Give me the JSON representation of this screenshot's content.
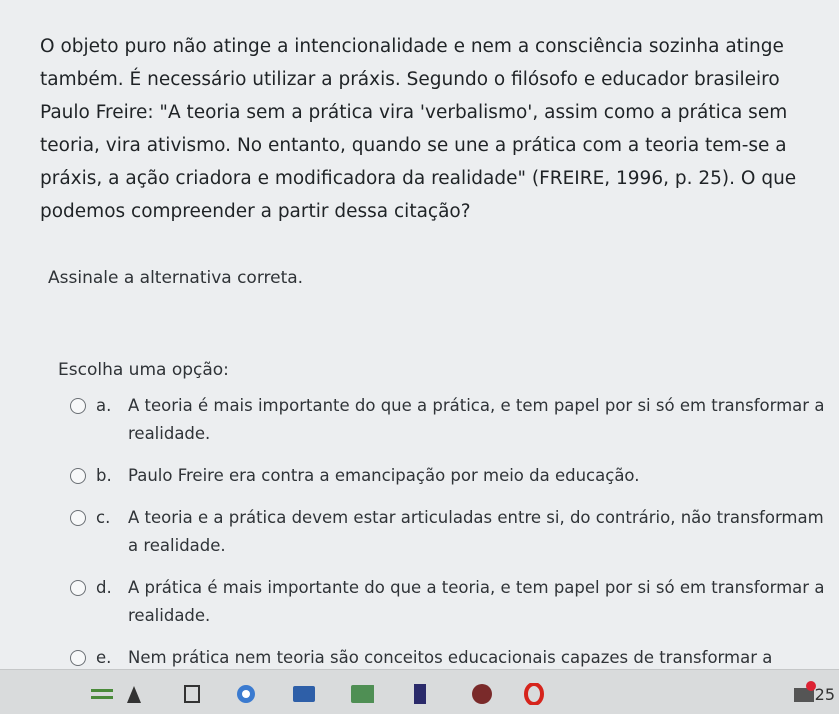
{
  "question": {
    "text": "O objeto puro não atinge a intencionalidade e nem a consciência sozinha atinge também. É necessário utilizar a práxis. Segundo o filósofo e educador brasileiro Paulo Freire: \"A teoria sem a prática vira 'verbalismo', assim como a prática sem teoria, vira ativismo. No entanto, quando se une a prática com a teoria tem-se a práxis, a ação criadora e modificadora da realidade\" (FREIRE, 1996, p. 25). O que podemos compreender a partir dessa citação?"
  },
  "instruction": "Assinale a alternativa correta.",
  "choose_label": "Escolha uma opção:",
  "options": [
    {
      "letter": "a.",
      "text": "A teoria é mais importante do que a prática, e tem papel por si só em transformar a realidade."
    },
    {
      "letter": "b.",
      "text": "Paulo Freire era contra a emancipação por meio da educação."
    },
    {
      "letter": "c.",
      "text": "A teoria e a prática devem estar articuladas entre si, do contrário, não transformam a realidade."
    },
    {
      "letter": "d.",
      "text": "A prática é mais importante do que a teoria, e tem papel por si só em transformar a realidade."
    },
    {
      "letter": "e.",
      "text": "Nem prática nem teoria são conceitos educacionais capazes de transformar a realidade."
    }
  ],
  "taskbar": {
    "icons": [
      "menu-icon",
      "clock-icon",
      "browser-icon",
      "folder-icon",
      "app-icon",
      "tv-icon",
      "security-icon",
      "opera-icon",
      "weather-icon"
    ],
    "clock": "25"
  }
}
